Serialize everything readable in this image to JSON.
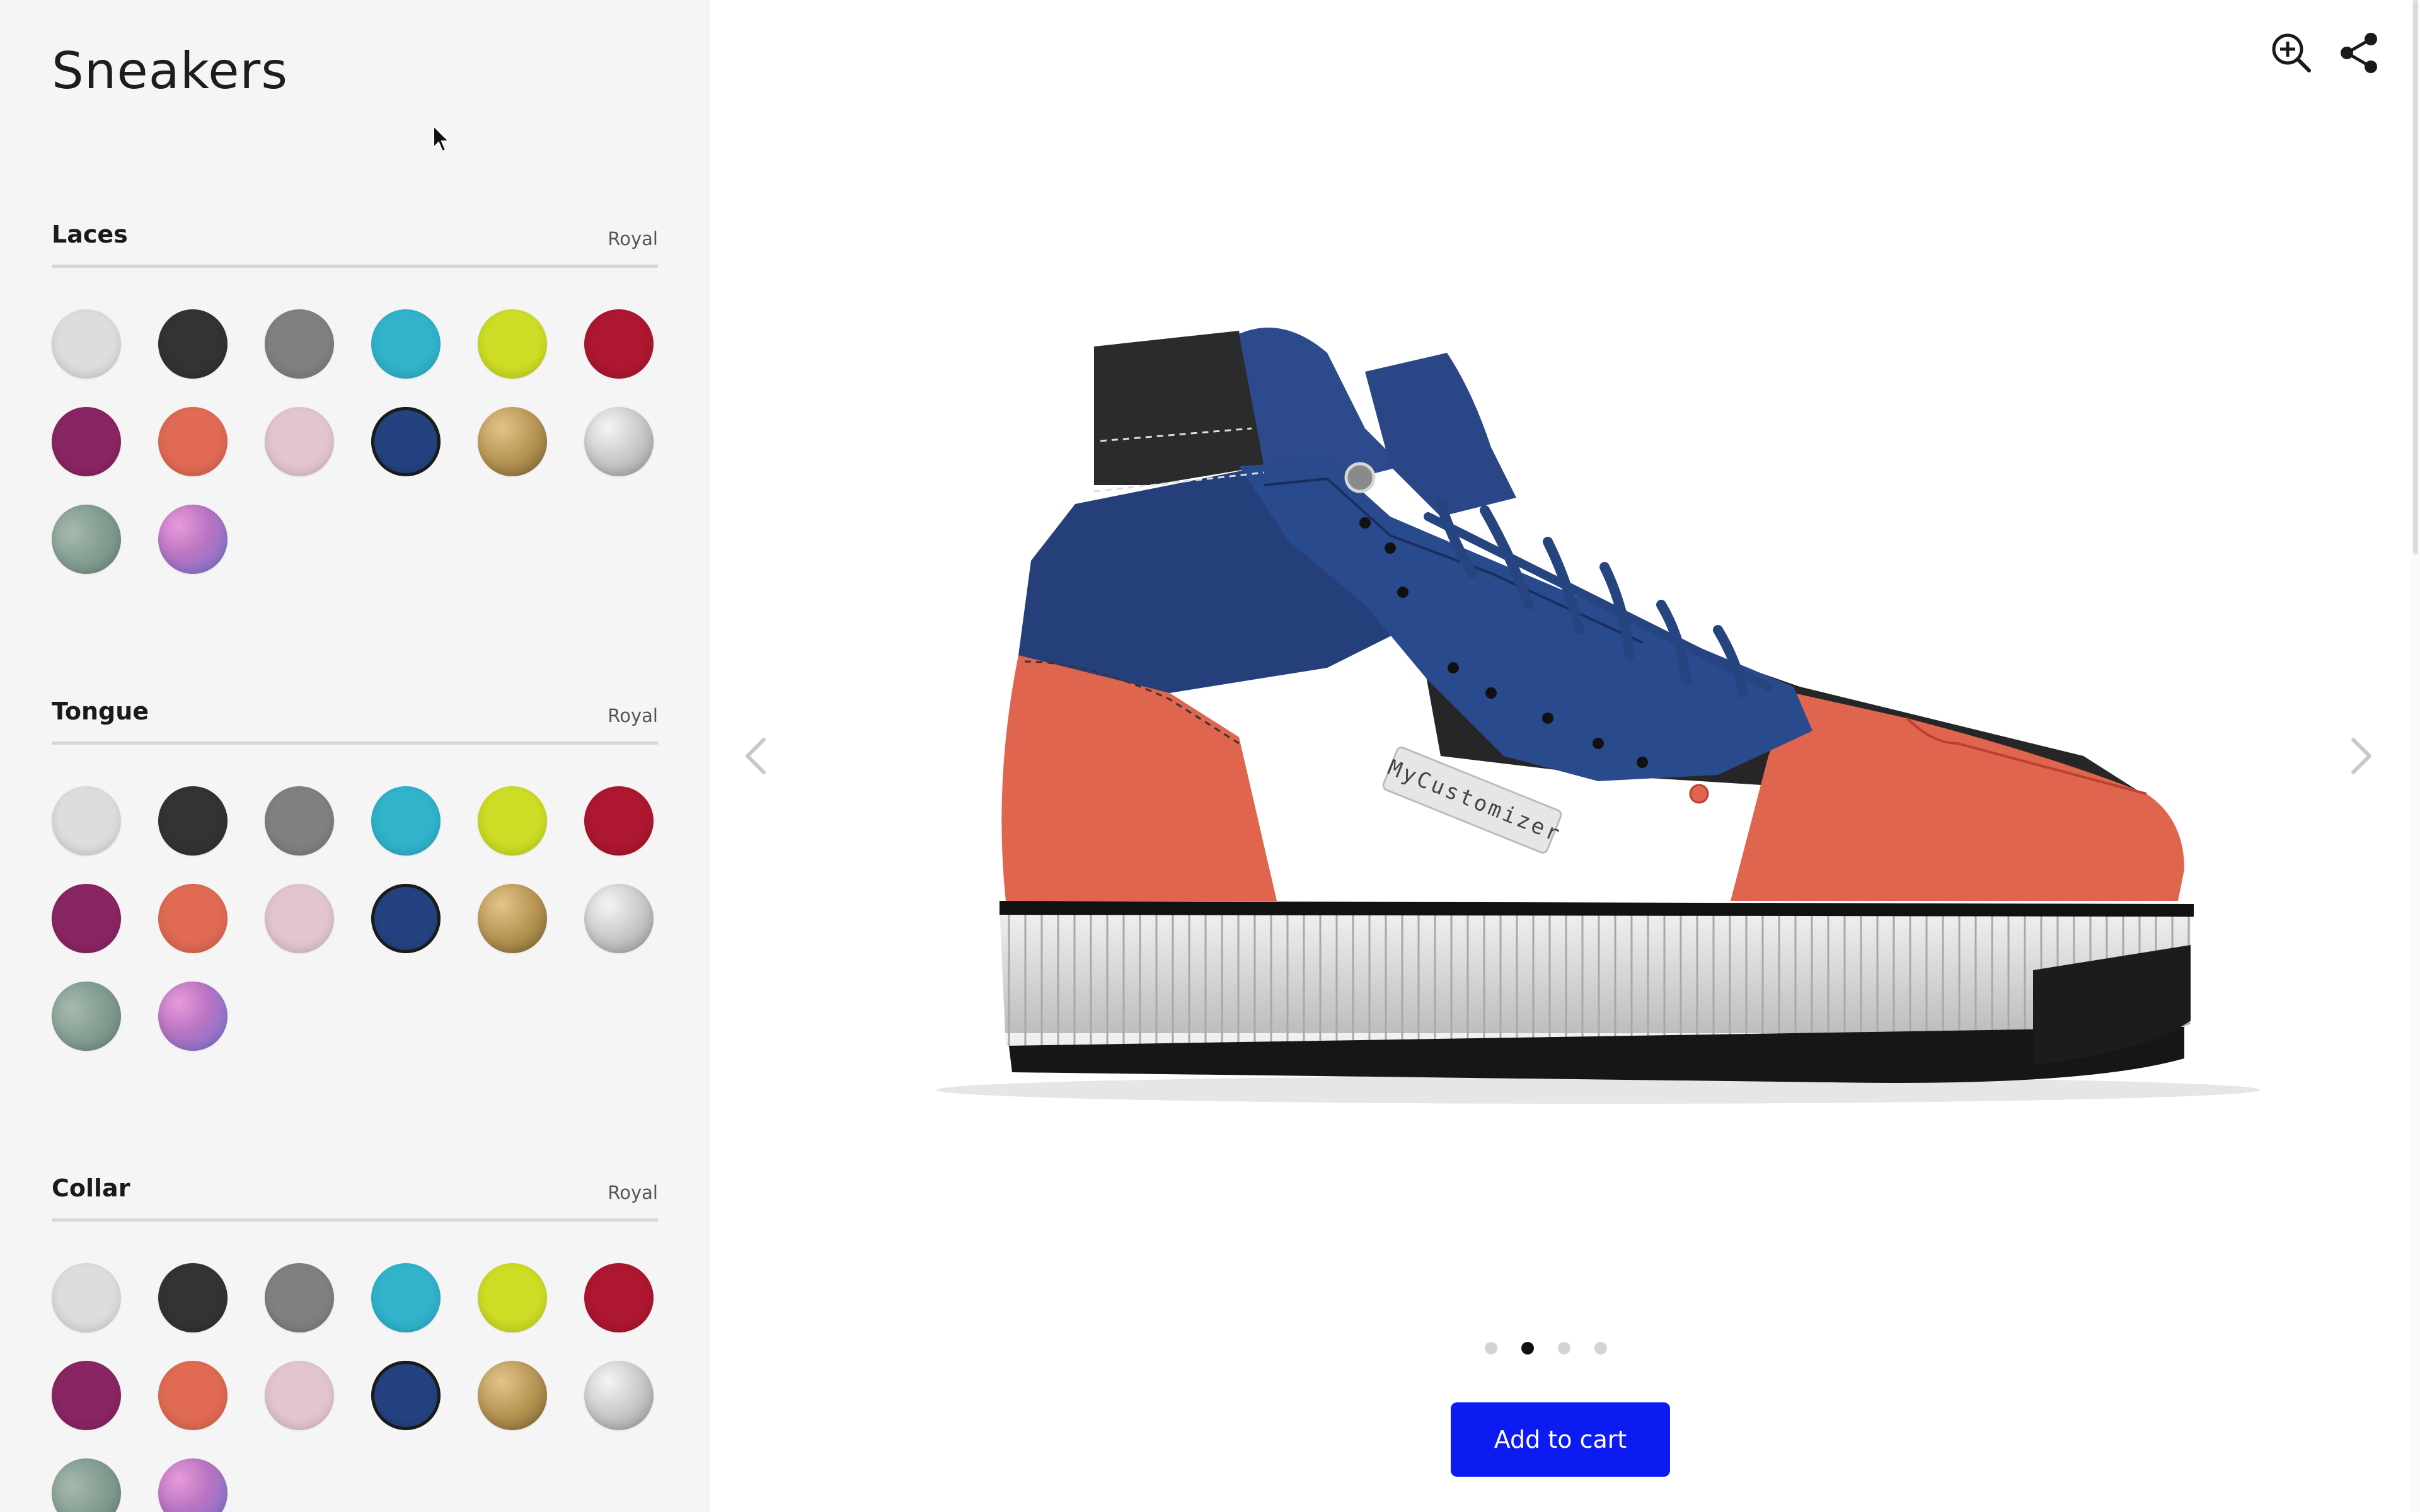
{
  "sidebar": {
    "title": "Sneakers",
    "groups": [
      {
        "name": "Laces",
        "value": "Royal"
      },
      {
        "name": "Tongue",
        "value": "Royal"
      },
      {
        "name": "Collar",
        "value": "Royal"
      }
    ],
    "swatch_colors": [
      {
        "name": "white",
        "color": "#dddddd"
      },
      {
        "name": "black",
        "color": "#333333"
      },
      {
        "name": "grey",
        "color": "#808080"
      },
      {
        "name": "turquoise",
        "color": "#30b3cb"
      },
      {
        "name": "lime",
        "color": "#cddc24"
      },
      {
        "name": "red",
        "color": "#ad1730"
      },
      {
        "name": "magenta",
        "color": "#8a2563"
      },
      {
        "name": "orange",
        "color": "#e06a53"
      },
      {
        "name": "pink",
        "color": "#e2c5d1"
      },
      {
        "name": "royal",
        "color": "#24427f"
      },
      {
        "name": "gold",
        "color": "#b3914f"
      },
      {
        "name": "silver",
        "color": "#c5c5c5"
      },
      {
        "name": "camo",
        "color": "#86a095"
      },
      {
        "name": "holographic",
        "color": "#b874c2"
      }
    ],
    "selected_swatch": "royal"
  },
  "viewer": {
    "badge_text": "MyCustomizer",
    "icons": [
      "zoom-in-icon",
      "share-icon",
      "chevron-left-icon",
      "chevron-right-icon"
    ],
    "view_count": 4,
    "active_view": 2,
    "add_to_cart_label": "Add to cart",
    "accent_color": "#0b1bf2"
  }
}
